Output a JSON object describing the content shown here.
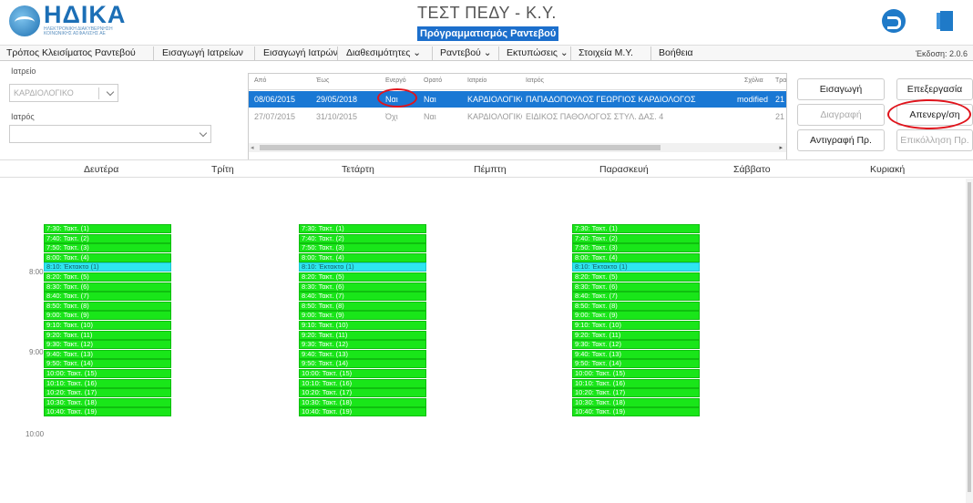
{
  "header": {
    "logo_text": "ΗΔΙΚΑ",
    "logo_sub": "ΗΛΕΚΤΡΟΝΙΚΗ ΔΙΑΚΥΒΕΡΝΗΣΗ ΚΟΙΝΩΝΙΚΗΣ ΑΣΦΑΛΙΣΗΣ ΑΕ",
    "title": "ΤΕΣΤ ΠΕΔΥ - Κ.Υ.",
    "subtitle": "Πρόγραμματισμός Ραντεβού",
    "back_icon": "refresh-arrow-icon",
    "exit_icon": "exit-door-icon"
  },
  "menu": {
    "items": [
      "Τρόπος Κλεισίματος Ραντεβού",
      "Εισαγωγή Ιατρείων",
      "Εισαγωγή Ιατρών",
      "Διαθεσιμότητες ⌄",
      "Ραντεβού ⌄",
      "Εκτυπώσεις ⌄",
      "Στοιχεία Μ.Υ.",
      "Βοήθεια"
    ],
    "version": "Έκδοση: 2.0.6"
  },
  "filters": {
    "clinic_label": "Ιατρείο",
    "clinic_value": "ΚΑΡΔΙΟΛΟΓΙΚΟ",
    "doctor_label": "Ιατρός",
    "doctor_value": ""
  },
  "grid": {
    "headers": [
      "Από",
      "Έως",
      "Ενεργό",
      "Ορατό",
      "Ιατρείο",
      "Ιατρός",
      "Σχόλια",
      "Τρα"
    ],
    "rows": [
      [
        "08/06/2015",
        "29/05/2018",
        "Ναι",
        "Ναι",
        "ΚΑΡΔΙΟΛΟΓΙΚΟ",
        "ΠΑΠΑΔΟΠΟΥΛΟΣ ΓΕΩΡΓΙΟΣ ΚΑΡΔΙΟΛΟΓΟΣ",
        "modified",
        "21"
      ],
      [
        "27/07/2015",
        "31/10/2015",
        "Όχι",
        "Ναι",
        "ΚΑΡΔΙΟΛΟΓΙΚΟ",
        "ΕΙΔΙΚΟΣ ΠΑΘΟΛΟΓΟΣ ΣΤΥΛ. ΔΑΣ. 4",
        "",
        "21"
      ]
    ]
  },
  "buttons": {
    "insert": "Εισαγωγή",
    "edit": "Επεξεργασία",
    "delete": "Διαγραφή",
    "deactivate": "Απενεργ/ση",
    "copy": "Αντιγραφή Πρ.",
    "paste": "Επικόλληση Πρ."
  },
  "calendar": {
    "days": [
      "Δευτέρα",
      "Τρίτη",
      "Τετάρτη",
      "Πέμπτη",
      "Παρασκευή",
      "Σάββατο",
      "Κυριακή"
    ],
    "hours": [
      "8:00",
      "9:00",
      "10:00"
    ],
    "slots": [
      {
        "label": "7:30: Τακτ. (1)",
        "type": "regular"
      },
      {
        "label": "7:40: Τακτ. (2)",
        "type": "regular"
      },
      {
        "label": "7:50: Τακτ. (3)",
        "type": "regular"
      },
      {
        "label": "8:00: Τακτ. (4)",
        "type": "regular"
      },
      {
        "label": "8:10: Έκτακτο (1)",
        "type": "extra"
      },
      {
        "label": "8:20: Τακτ. (5)",
        "type": "regular"
      },
      {
        "label": "8:30: Τακτ. (6)",
        "type": "regular"
      },
      {
        "label": "8:40: Τακτ. (7)",
        "type": "regular"
      },
      {
        "label": "8:50: Τακτ. (8)",
        "type": "regular"
      },
      {
        "label": "9:00: Τακτ. (9)",
        "type": "regular"
      },
      {
        "label": "9:10: Τακτ. (10)",
        "type": "regular"
      },
      {
        "label": "9:20: Τακτ. (11)",
        "type": "regular"
      },
      {
        "label": "9:30: Τακτ. (12)",
        "type": "regular"
      },
      {
        "label": "9:40: Τακτ. (13)",
        "type": "regular"
      },
      {
        "label": "9:50: Τακτ. (14)",
        "type": "regular"
      },
      {
        "label": "10:00: Τακτ. (15)",
        "type": "regular"
      },
      {
        "label": "10:10: Τακτ. (16)",
        "type": "regular"
      },
      {
        "label": "10:20: Τακτ. (17)",
        "type": "regular"
      },
      {
        "label": "10:30: Τακτ. (18)",
        "type": "regular"
      },
      {
        "label": "10:40: Τακτ. (19)",
        "type": "regular"
      }
    ],
    "slot_days": [
      0,
      2,
      4
    ],
    "colors": {
      "regular": "#19e619",
      "extra": "#2ee6f0",
      "selected_row": "#1a78d4",
      "highlight": "#e0141c"
    }
  }
}
